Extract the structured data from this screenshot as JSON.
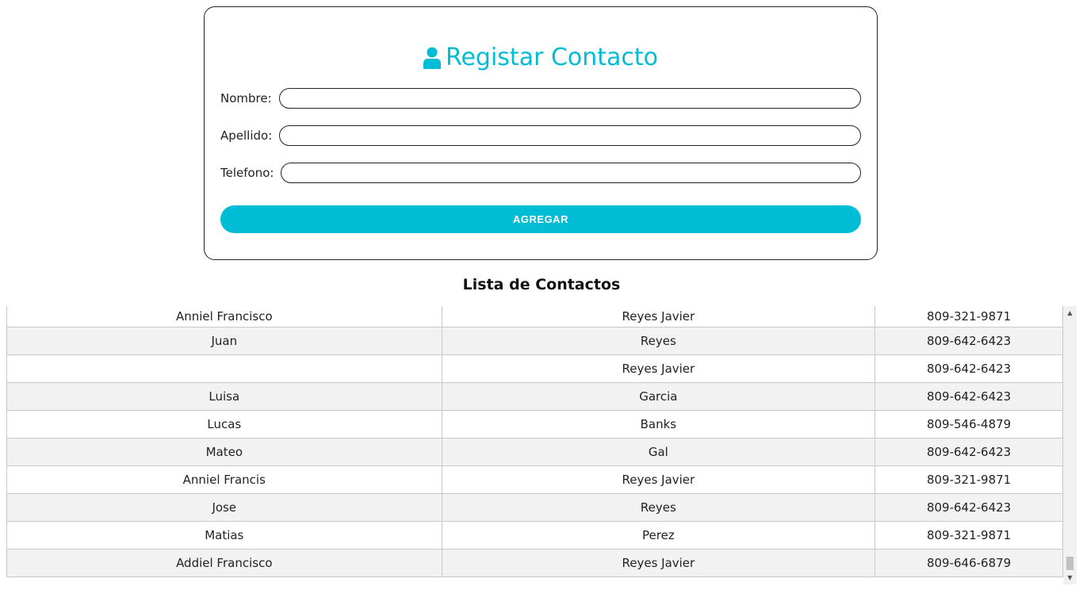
{
  "form": {
    "title": "Registar Contacto",
    "icon": "user-icon",
    "accent_color": "#00bcd4",
    "fields": [
      {
        "label": "Nombre:",
        "value": ""
      },
      {
        "label": "Apellido:",
        "value": ""
      },
      {
        "label": "Telefono:",
        "value": ""
      }
    ],
    "submit_label": "AGREGAR"
  },
  "list": {
    "title": "Lista de Contactos",
    "rows": [
      {
        "nombre": "Anniel Francisco",
        "apellido": "Reyes Javier",
        "telefono": "809-321-9871"
      },
      {
        "nombre": "Juan",
        "apellido": "Reyes",
        "telefono": "809-642-6423"
      },
      {
        "nombre": "",
        "apellido": "Reyes Javier",
        "telefono": "809-642-6423"
      },
      {
        "nombre": "Luisa",
        "apellido": "Garcia",
        "telefono": "809-642-6423"
      },
      {
        "nombre": "Lucas",
        "apellido": "Banks",
        "telefono": "809-546-4879"
      },
      {
        "nombre": "Mateo",
        "apellido": "Gal",
        "telefono": "809-642-6423"
      },
      {
        "nombre": "Anniel Francis",
        "apellido": "Reyes Javier",
        "telefono": "809-321-9871"
      },
      {
        "nombre": "Jose",
        "apellido": "Reyes",
        "telefono": "809-642-6423"
      },
      {
        "nombre": "Matias",
        "apellido": "Perez",
        "telefono": "809-321-9871"
      },
      {
        "nombre": "Addiel Francisco",
        "apellido": "Reyes Javier",
        "telefono": "809-646-6879"
      }
    ]
  },
  "scrollbar": {
    "up_icon": "arrow-up-icon",
    "down_icon": "arrow-down-icon"
  }
}
